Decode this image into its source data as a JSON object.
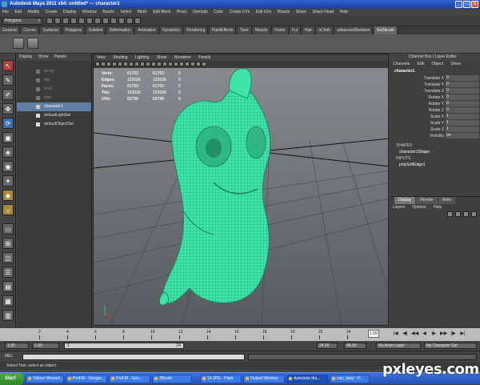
{
  "window": {
    "title": "Autodesk Maya 2011 x64: untitled*   ---   character1",
    "controls": [
      "_",
      "□",
      "x"
    ]
  },
  "menubar": {
    "items": [
      "File",
      "Edit",
      "Modify",
      "Create",
      "Display",
      "Window",
      "Assets",
      "Select",
      "Mesh",
      "Edit Mesh",
      "Proxy",
      "Normals",
      "Color",
      "Create UVs",
      "Edit UVs",
      "Muscle",
      "Share",
      "Share Head",
      "Help"
    ]
  },
  "statusline": {
    "mode": "Polygons"
  },
  "shelf": {
    "tabs": [
      "General",
      "Curves",
      "Surfaces",
      "Polygons",
      "Subdivs",
      "Deformation",
      "Animation",
      "Dynamics",
      "Rendering",
      "PaintEffects",
      "Toon",
      "Muscle",
      "Fluids",
      "Fur",
      "Hair",
      "nCloth",
      "advancedSkeleton",
      "GoZbrush"
    ],
    "active_tab": "GoZbrush"
  },
  "outliner": {
    "menu": [
      "Display",
      "Show",
      "Panels"
    ],
    "items": [
      {
        "label": "persp",
        "state": "dim"
      },
      {
        "label": "top",
        "state": "dim"
      },
      {
        "label": "front",
        "state": "dim"
      },
      {
        "label": "side",
        "state": "dim"
      },
      {
        "label": "character1",
        "state": "selected"
      },
      {
        "label": "defaultLightSet",
        "state": "set"
      },
      {
        "label": "defaultObjectSet",
        "state": "set"
      }
    ]
  },
  "viewport": {
    "menu": [
      "View",
      "Shading",
      "Lighting",
      "Show",
      "Renderer",
      "Panels"
    ],
    "hud": [
      {
        "label": "Verts:",
        "v1": "61763",
        "v2": "61763",
        "v3": "0"
      },
      {
        "label": "Edges:",
        "v1": "123526",
        "v2": "123526",
        "v3": "0"
      },
      {
        "label": "Faces:",
        "v1": "61760",
        "v2": "61760",
        "v3": "0"
      },
      {
        "label": "Tris:",
        "v1": "123520",
        "v2": "123520",
        "v3": "0"
      },
      {
        "label": "UVs:",
        "v1": "62798",
        "v2": "62798",
        "v3": "0"
      }
    ],
    "mesh_color": "#3de6a8"
  },
  "channelbox": {
    "title": "Channel Box / Layer Editor",
    "menu": [
      "Channels",
      "Edit",
      "Object",
      "Show"
    ],
    "object": "character1",
    "attributes": [
      {
        "name": "Translate X",
        "value": "0"
      },
      {
        "name": "Translate Y",
        "value": "0"
      },
      {
        "name": "Translate Z",
        "value": "0"
      },
      {
        "name": "Rotate X",
        "value": "0"
      },
      {
        "name": "Rotate Y",
        "value": "0"
      },
      {
        "name": "Rotate Z",
        "value": "0"
      },
      {
        "name": "Scale X",
        "value": "1"
      },
      {
        "name": "Scale Y",
        "value": "1"
      },
      {
        "name": "Scale Z",
        "value": "1"
      },
      {
        "name": "Visibility",
        "value": "on"
      }
    ],
    "shapes_label": "SHAPES",
    "shape_node": "character1Shape",
    "inputs_label": "INPUTS",
    "input_node": "polySoftEdge1"
  },
  "layers": {
    "tabs": [
      "Display",
      "Render",
      "Anim"
    ],
    "menu": [
      "Layers",
      "Options",
      "Help"
    ]
  },
  "timeline": {
    "ticks": [
      "2",
      "4",
      "6",
      "8",
      "10",
      "12",
      "14",
      "16",
      "18",
      "20",
      "22",
      "24"
    ],
    "current_frame": "1.00",
    "playback": [
      "|◀",
      "◀|",
      "◀◀",
      "◀",
      "▶",
      "▶▶",
      "|▶",
      "▶|"
    ]
  },
  "range": {
    "start": "1.00",
    "anim_start": "1.00",
    "bar_start": "1",
    "bar_end": "24",
    "end": "24.00",
    "anim_end": "48.00",
    "anim_layer": "No Anim Layer",
    "character_set": "No Character Set"
  },
  "cmdline": {
    "label": "MEL"
  },
  "helpline": {
    "text": "Select Tool: select an object"
  },
  "taskbar": {
    "start": "Start",
    "items": [
      {
        "label": "Yahoo! Messen...",
        "active": false
      },
      {
        "label": "ProFM - Google...",
        "active": false
      },
      {
        "label": "ProFM - Goo...",
        "active": false
      },
      {
        "label": "ZBrush",
        "active": false
      },
      {
        "label": "14.JPG - Paint",
        "active": false
      },
      {
        "label": "Output Window",
        "active": false
      },
      {
        "label": "Autodesk Ma...",
        "active": true
      },
      {
        "label": "van_duny : P...",
        "active": false
      }
    ]
  },
  "watermark": "pxleyes.com"
}
